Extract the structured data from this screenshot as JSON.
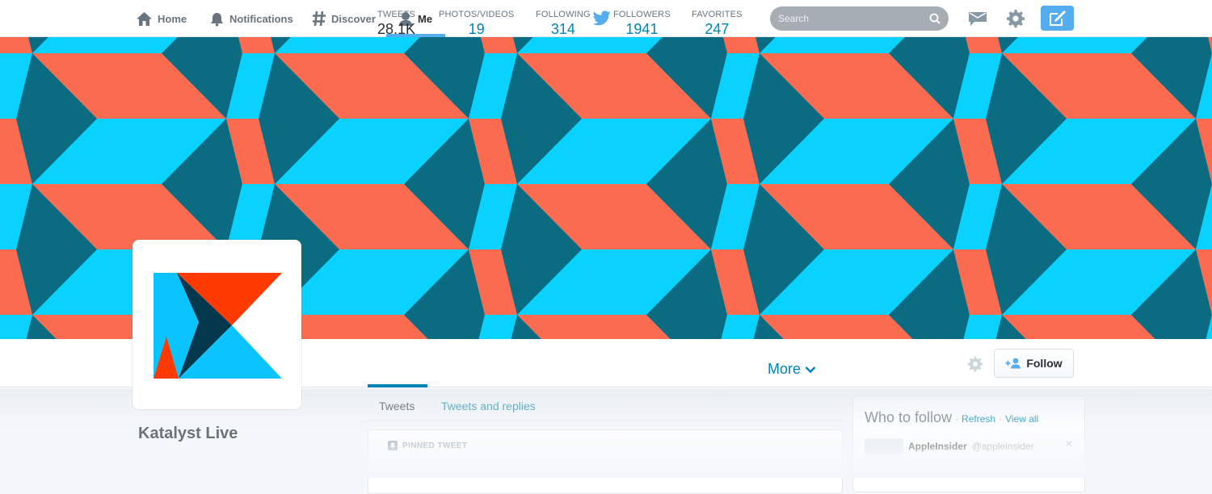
{
  "nav": {
    "items": [
      {
        "label": "Home",
        "icon": "home-icon"
      },
      {
        "label": "Notifications",
        "icon": "bell-icon"
      },
      {
        "label": "Discover",
        "icon": "hashtag-icon"
      },
      {
        "label": "Me",
        "icon": "person-icon",
        "active": true
      }
    ],
    "logo": "twitter-bird-icon",
    "search": {
      "placeholder": "Search"
    },
    "accent": "#55acee"
  },
  "banner": {
    "colors": {
      "coral": "#fa6b50",
      "cyan": "#0ad2ff",
      "teal": "#0b6b80"
    }
  },
  "profile": {
    "name": "Katalyst Live",
    "logo_colors": {
      "cyan": "#0ac3ff",
      "red": "#ff3a00",
      "navy": "#03384c"
    }
  },
  "stats": [
    {
      "label": "TWEETS",
      "value": "28.1K",
      "active": true
    },
    {
      "label": "PHOTOS/VIDEOS",
      "value": "19"
    },
    {
      "label": "FOLLOWING",
      "value": "314"
    },
    {
      "label": "FOLLOWERS",
      "value": "1941"
    },
    {
      "label": "FAVORITES",
      "value": "247"
    }
  ],
  "more_label": "More",
  "follow_label": "Follow",
  "tabs": [
    {
      "label": "Tweets",
      "active": true
    },
    {
      "label": "Tweets and replies"
    }
  ],
  "pinned": {
    "label": "PINNED TWEET"
  },
  "who_to_follow": {
    "title": "Who to follow",
    "separator": "·",
    "refresh": "Refresh",
    "view_all": "View all",
    "users": [
      {
        "name": "AppleInsider",
        "handle": "@appleinsider"
      }
    ]
  }
}
